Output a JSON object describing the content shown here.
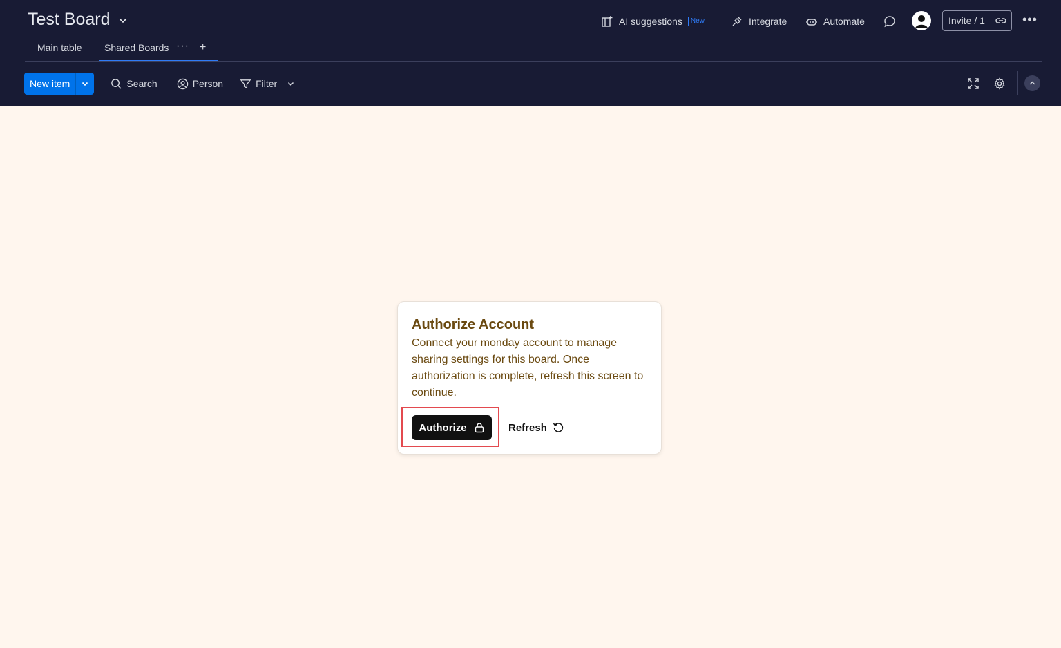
{
  "board": {
    "title": "Test Board"
  },
  "tabs": [
    {
      "label": "Main table"
    },
    {
      "label": "Shared Boards"
    }
  ],
  "header": {
    "ai_suggestions": "AI suggestions",
    "new_badge": "New",
    "integrate": "Integrate",
    "automate": "Automate",
    "invite": "Invite / 1",
    "more": "•••"
  },
  "toolbar": {
    "new_item": "New item",
    "search": "Search",
    "person": "Person",
    "filter": "Filter"
  },
  "dialog": {
    "title": "Authorize Account",
    "message": "Connect your monday account to manage sharing settings for this board. Once authorization is complete, refresh this screen to continue.",
    "authorize_label": "Authorize",
    "refresh_label": "Refresh"
  },
  "colors": {
    "topbar": "#181b34",
    "page_background": "#fff6ee",
    "primary": "#0073ea",
    "dialog_text": "#6b4a11",
    "highlight": "#e34a4f"
  }
}
